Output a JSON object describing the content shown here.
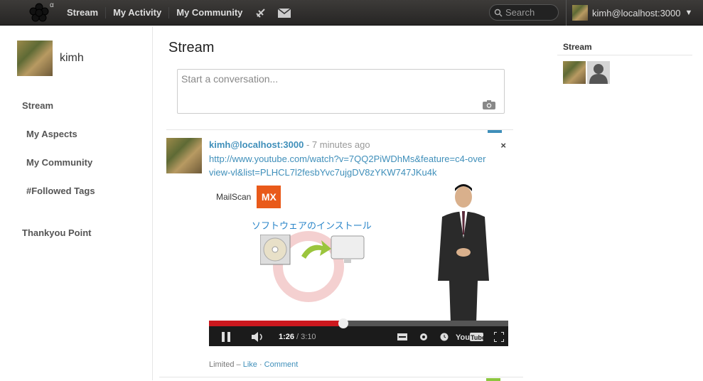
{
  "nav": {
    "logo_alpha": "α",
    "stream": "Stream",
    "my_activity": "My Activity",
    "my_community": "My Community",
    "search_placeholder": "Search",
    "user": "kimh@localhost:3000",
    "user_menu_arrow": "▼"
  },
  "sidebar": {
    "username": "kimh",
    "items": [
      "Stream",
      "My Aspects",
      "My Community",
      "#Followed Tags",
      "Thankyou Point"
    ]
  },
  "main": {
    "title": "Stream",
    "publisher_placeholder": "Start a conversation...",
    "post": {
      "author": "kimh@localhost:3000",
      "time": " - 7 minutes ago",
      "close": "×",
      "link": "http://www.youtube.com/watch?v=7QQ2PiWDhMs&feature=c4-overview-vl&list=PLHCL7l2fesbYvc7ujgDV8zYKW747JKu4k",
      "video": {
        "mailscan": "MailScan",
        "mx": "MX",
        "jp_title": "ソフトウェアのインストール",
        "current_time": "1:26",
        "duration": "/ 3:10",
        "progress_fraction": 0.45
      },
      "footer": {
        "visibility": "Limited",
        "sep": " – ",
        "like": "Like",
        "dot": " · ",
        "comment": "Comment"
      }
    }
  },
  "right": {
    "title": "Stream"
  },
  "colors": {
    "link": "#3f8fba",
    "topbar": "#2f2d2b",
    "youtube_red": "#cc181e"
  }
}
